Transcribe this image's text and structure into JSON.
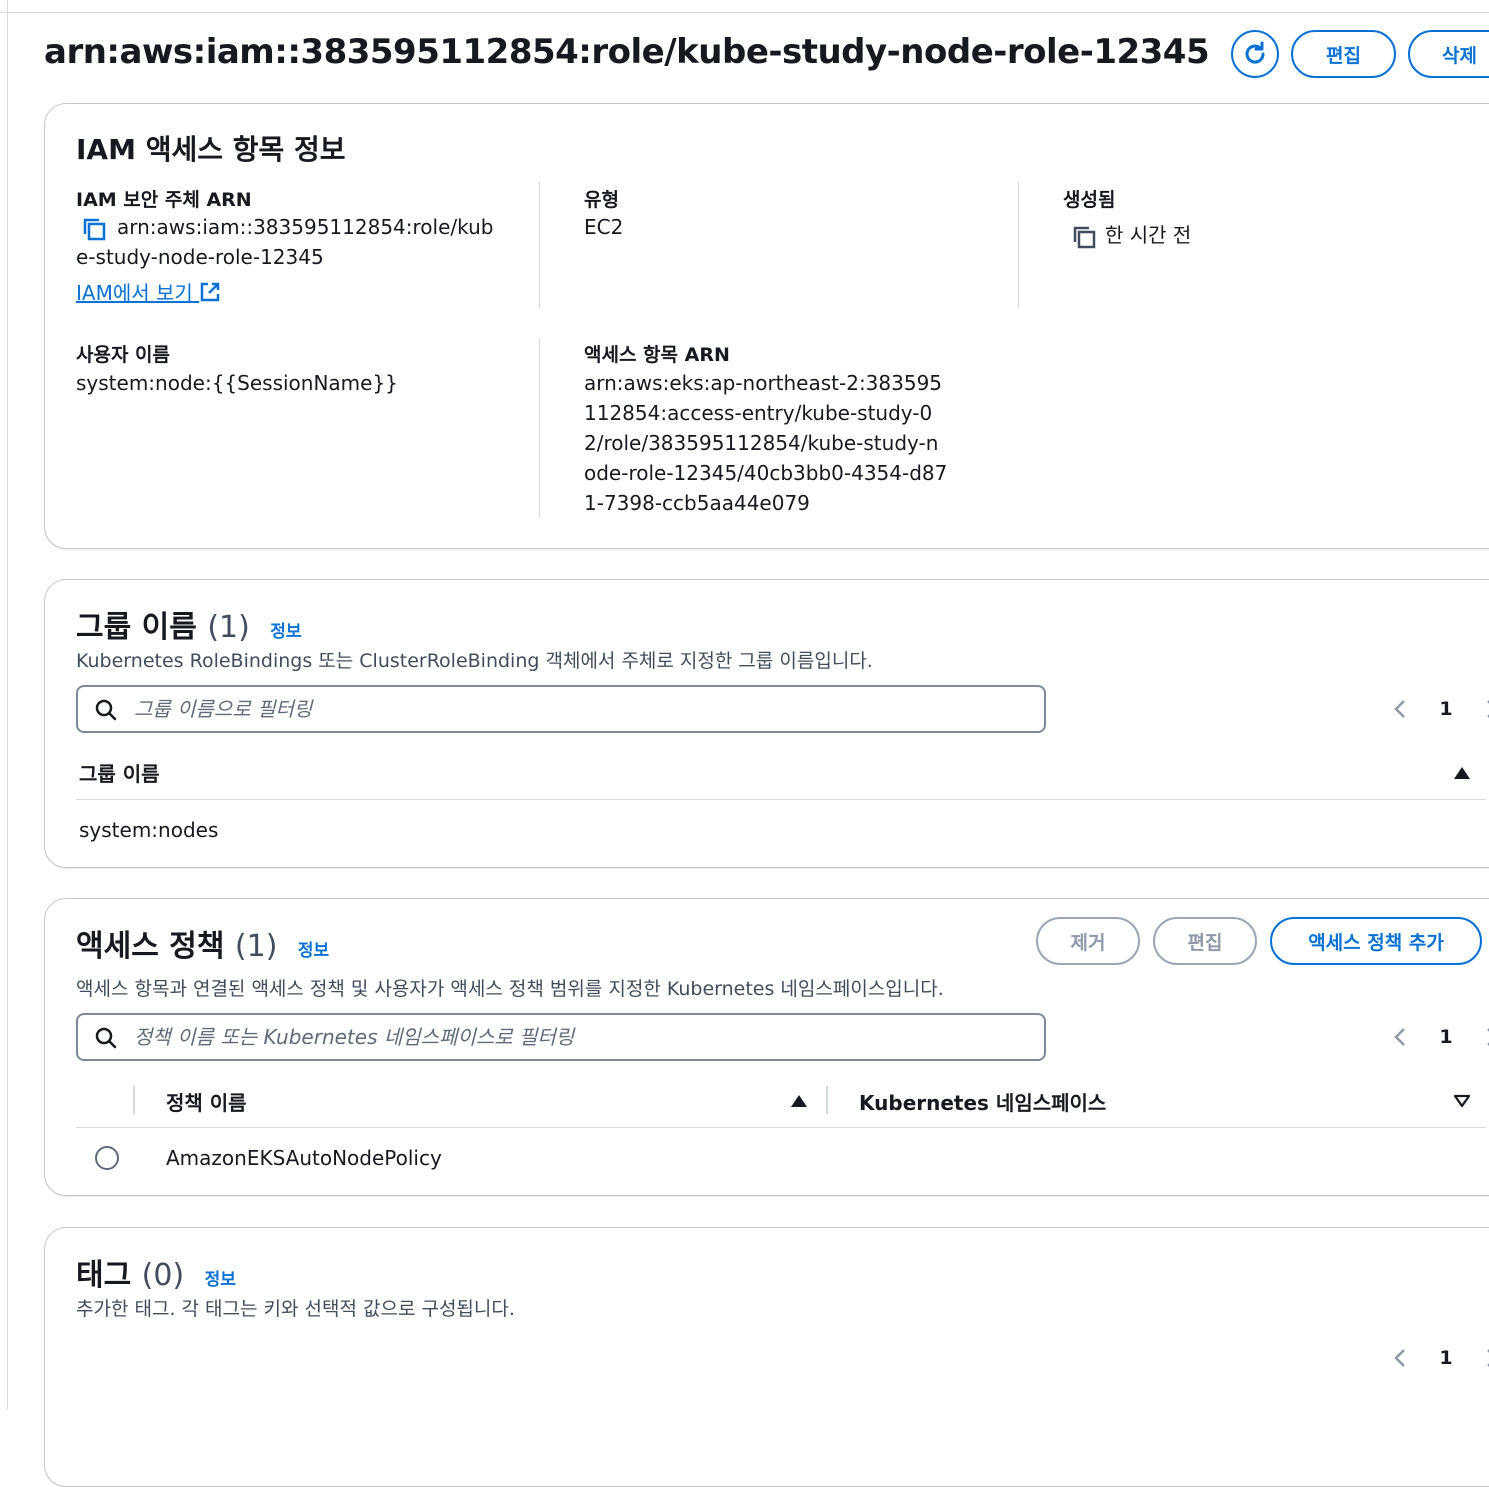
{
  "header": {
    "title": "arn:aws:iam::383595112854:role/kube-study-node-role-12345",
    "edit_label": "편집",
    "delete_label": "삭제"
  },
  "details": {
    "title": "IAM 액세스 항목 정보",
    "principal_arn_label": "IAM 보안 주체 ARN",
    "principal_arn_value": "arn:aws:iam::383595112854:role/kube-study-node-role-12345",
    "view_in_iam_label": "IAM에서 보기",
    "type_label": "유형",
    "type_value": "EC2",
    "created_label": "생성됨",
    "created_value": "한 시간 전",
    "username_label": "사용자 이름",
    "username_value": "system:node:{{SessionName}}",
    "entry_arn_label": "액세스 항목 ARN",
    "entry_arn_value": "arn:aws:eks:ap-northeast-2:383595112854:access-entry/kube-study-02/role/383595112854/kube-study-node-role-12345/40cb3bb0-4354-d871-7398-ccb5aa44e079"
  },
  "groups": {
    "title": "그룹 이름",
    "count": "(1)",
    "info": "정보",
    "description": "Kubernetes RoleBindings 또는 ClusterRoleBinding 객체에서 주체로 지정한 그룹 이름입니다.",
    "filter_placeholder": "그룹 이름으로 필터링",
    "page": "1",
    "column_header": "그룹 이름",
    "rows": [
      "system:nodes"
    ]
  },
  "policies": {
    "title": "액세스 정책",
    "count": "(1)",
    "info": "정보",
    "remove_label": "제거",
    "edit_label": "편집",
    "add_label": "액세스 정책 추가",
    "description": "액세스 항목과 연결된 액세스 정책 및 사용자가 액세스 정책 범위를 지정한 Kubernetes 네임스페이스입니다.",
    "filter_placeholder": "정책 이름 또는 Kubernetes 네임스페이스로 필터링",
    "page": "1",
    "columns": [
      "정책 이름",
      "Kubernetes 네임스페이스"
    ],
    "rows": [
      {
        "name": "AmazonEKSAutoNodePolicy",
        "namespace": ""
      }
    ]
  },
  "tags": {
    "title": "태그",
    "count": "(0)",
    "info": "정보",
    "description": "추가한 태그. 각 태그는 키와 선택적 값으로 구성됩니다.",
    "page": "1"
  },
  "colors": {
    "primary": "#0972d3",
    "text": "#16191f",
    "muted": "#414d5c",
    "border": "#c6c6cd",
    "disabled": "#8d99a8"
  },
  "icons": [
    "refresh-icon",
    "copy-icon",
    "external-link-icon",
    "search-icon",
    "chevron-left-icon",
    "chevron-right-icon",
    "sort-asc-icon",
    "sort-desc-icon",
    "radio-icon"
  ]
}
